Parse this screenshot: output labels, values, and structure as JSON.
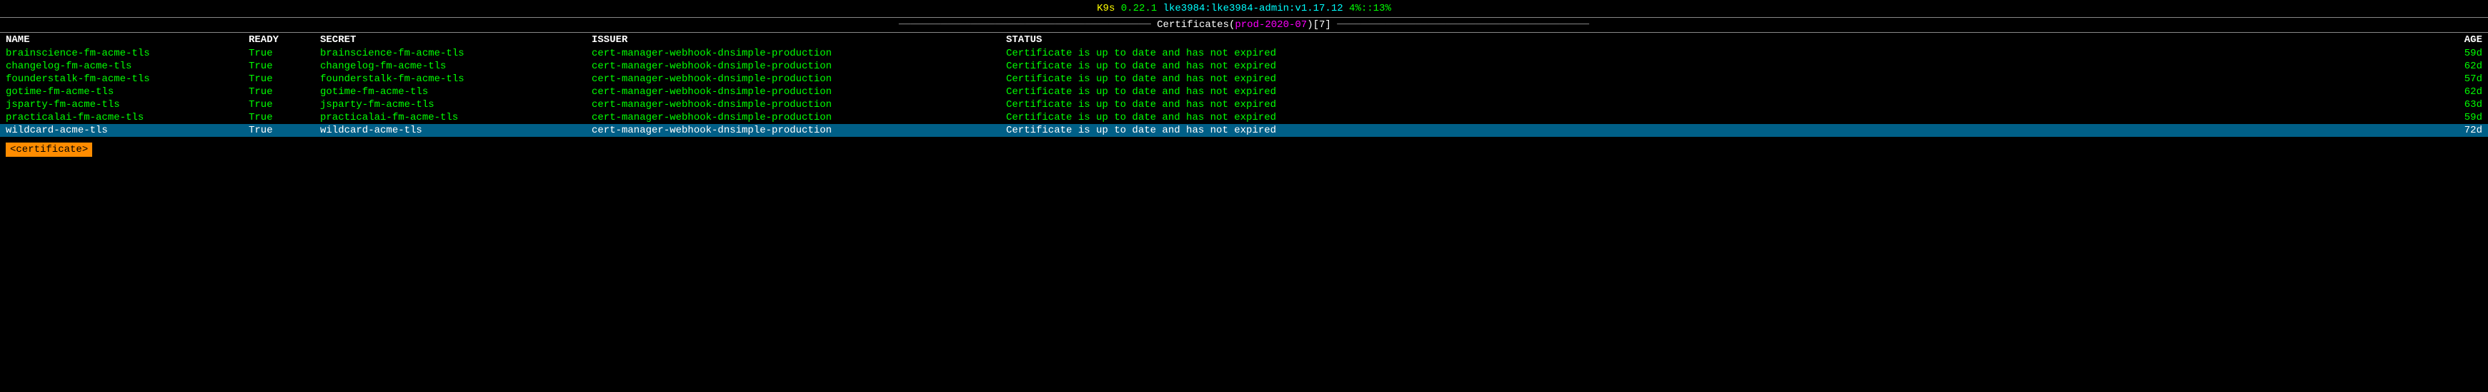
{
  "titleBar": {
    "k9s_label": "K9s",
    "version": "0.22.1",
    "context": "lke3984:lke3984-admin:v1.17.12",
    "cpu": "4%::13%"
  },
  "sectionHeader": {
    "prefix_dashes": "──────────────────────────────────────────",
    "title_prefix": " Certificates(",
    "namespace": "prod-2020-07",
    "title_suffix": ")",
    "count": "[7]",
    "suffix_dashes": "──────────────────────────────────────────"
  },
  "columns": {
    "name": "NAME",
    "ready": "READY",
    "secret": "SECRET",
    "issuer": "ISSUER",
    "status": "STATUS",
    "age": "AGE"
  },
  "rows": [
    {
      "name": "brainscience-fm-acme-tls",
      "ready": "True",
      "secret": "brainscience-fm-acme-tls",
      "issuer": "cert-manager-webhook-dnsimple-production",
      "status": "Certificate is up to date and has not expired",
      "age": "59d",
      "selected": false
    },
    {
      "name": "changelog-fm-acme-tls",
      "ready": "True",
      "secret": "changelog-fm-acme-tls",
      "issuer": "cert-manager-webhook-dnsimple-production",
      "status": "Certificate is up to date and has not expired",
      "age": "62d",
      "selected": false
    },
    {
      "name": "founderstalk-fm-acme-tls",
      "ready": "True",
      "secret": "founderstalk-fm-acme-tls",
      "issuer": "cert-manager-webhook-dnsimple-production",
      "status": "Certificate is up to date and has not expired",
      "age": "57d",
      "selected": false
    },
    {
      "name": "gotime-fm-acme-tls",
      "ready": "True",
      "secret": "gotime-fm-acme-tls",
      "issuer": "cert-manager-webhook-dnsimple-production",
      "status": "Certificate is up to date and has not expired",
      "age": "62d",
      "selected": false
    },
    {
      "name": "jsparty-fm-acme-tls",
      "ready": "True",
      "secret": "jsparty-fm-acme-tls",
      "issuer": "cert-manager-webhook-dnsimple-production",
      "status": "Certificate is up to date and has not expired",
      "age": "63d",
      "selected": false
    },
    {
      "name": "practicalai-fm-acme-tls",
      "ready": "True",
      "secret": "practicalai-fm-acme-tls",
      "issuer": "cert-manager-webhook-dnsimple-production",
      "status": "Certificate is up to date and has not expired",
      "age": "59d",
      "selected": false
    },
    {
      "name": "wildcard-acme-tls",
      "ready": "True",
      "secret": "wildcard-acme-tls",
      "issuer": "cert-manager-webhook-dnsimple-production",
      "status": "Certificate is up to date and has not expired",
      "age": "72d",
      "selected": true
    }
  ],
  "footer": {
    "badge": "<certificate>"
  }
}
